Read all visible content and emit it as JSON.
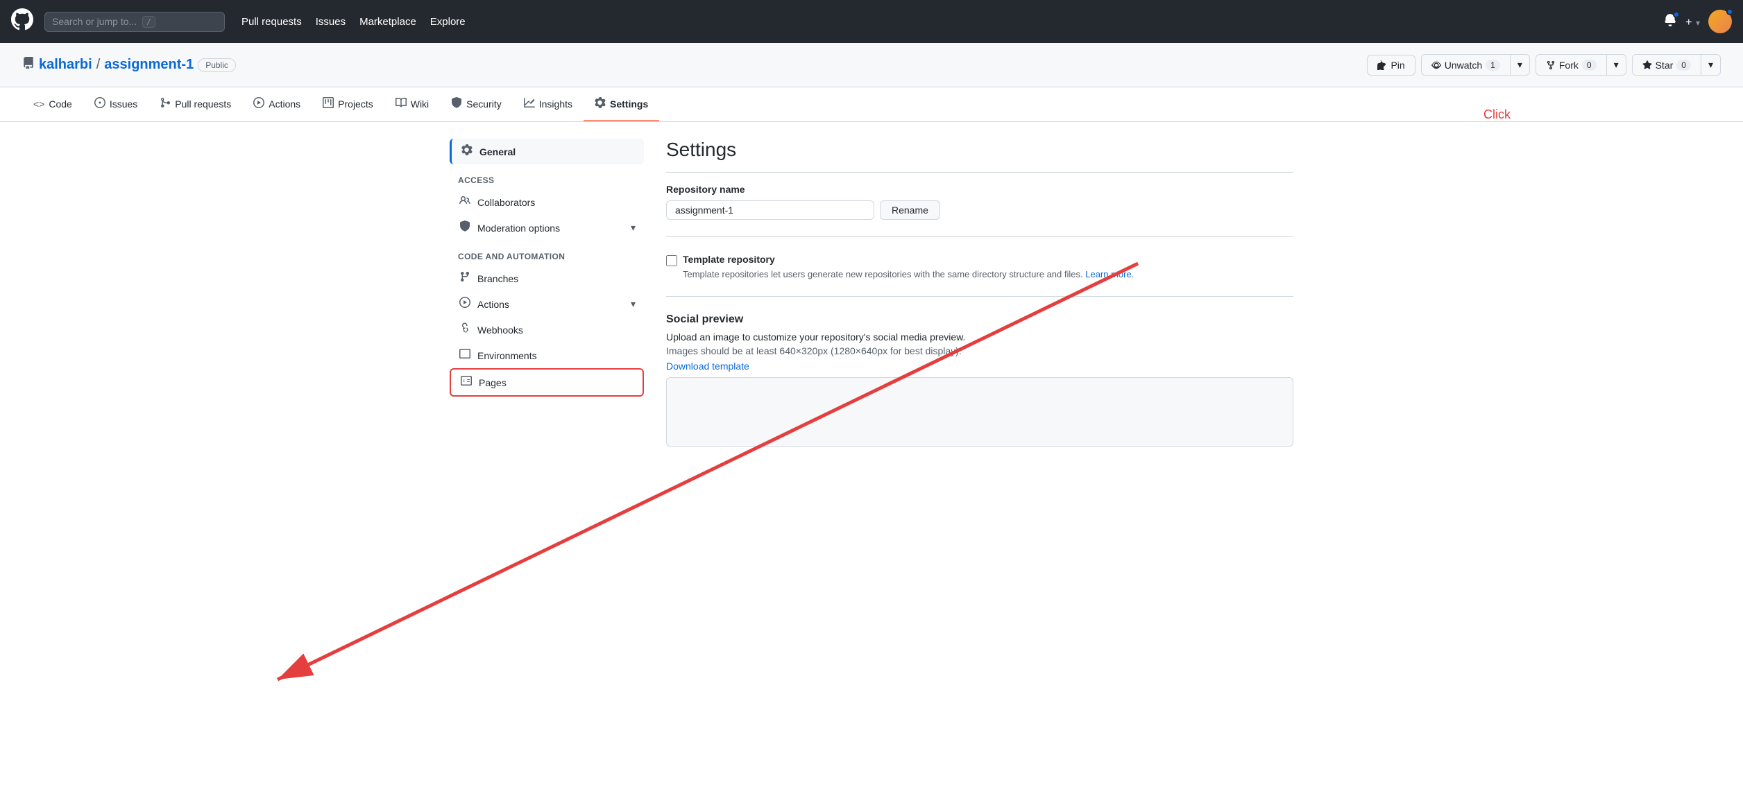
{
  "topnav": {
    "search_placeholder": "Search or jump to...",
    "search_kbd": "/",
    "links": [
      "Pull requests",
      "Issues",
      "Marketplace",
      "Explore"
    ],
    "notification_icon": "🔔",
    "plus_label": "+",
    "colors": {
      "bg": "#24292f"
    }
  },
  "repo": {
    "owner": "kalharbi",
    "name": "assignment-1",
    "badge": "Public",
    "pin_label": "Pin",
    "unwatch_label": "Unwatch",
    "unwatch_count": "1",
    "fork_label": "Fork",
    "fork_count": "0",
    "star_label": "Star",
    "star_count": "0"
  },
  "tabs": [
    {
      "label": "Code",
      "icon": "<>"
    },
    {
      "label": "Issues",
      "icon": "○"
    },
    {
      "label": "Pull requests",
      "icon": "⑂"
    },
    {
      "label": "Actions",
      "icon": "▷"
    },
    {
      "label": "Projects",
      "icon": "⊞"
    },
    {
      "label": "Wiki",
      "icon": "📖"
    },
    {
      "label": "Security",
      "icon": "🛡"
    },
    {
      "label": "Insights",
      "icon": "📊"
    },
    {
      "label": "Settings",
      "icon": "⚙",
      "active": true
    }
  ],
  "sidebar": {
    "general_label": "General",
    "access_section": "Access",
    "access_items": [
      {
        "label": "Collaborators",
        "icon": "👤"
      },
      {
        "label": "Moderation options",
        "icon": "🛡",
        "chevron": true
      }
    ],
    "code_section": "Code and automation",
    "code_items": [
      {
        "label": "Branches",
        "icon": "⑂"
      },
      {
        "label": "Actions",
        "icon": "▷",
        "chevron": true
      },
      {
        "label": "Webhooks",
        "icon": "◎"
      },
      {
        "label": "Environments",
        "icon": "⊟"
      },
      {
        "label": "Pages",
        "icon": "⊟",
        "boxed": true
      }
    ]
  },
  "settings": {
    "title": "Settings",
    "repo_name_label": "Repository name",
    "repo_name_value": "assignment-1",
    "rename_btn": "Rename",
    "template_label": "Template repository",
    "template_desc": "Template repositories let users generate new repositories with the same directory structure and files.",
    "learn_more": "Learn more.",
    "social_preview_title": "Social preview",
    "social_preview_desc": "Upload an image to customize your repository's social media preview.",
    "social_preview_sub": "Images should be at least 640×320px (1280×640px for best display).",
    "download_template": "Download template",
    "click_label": "Click"
  }
}
